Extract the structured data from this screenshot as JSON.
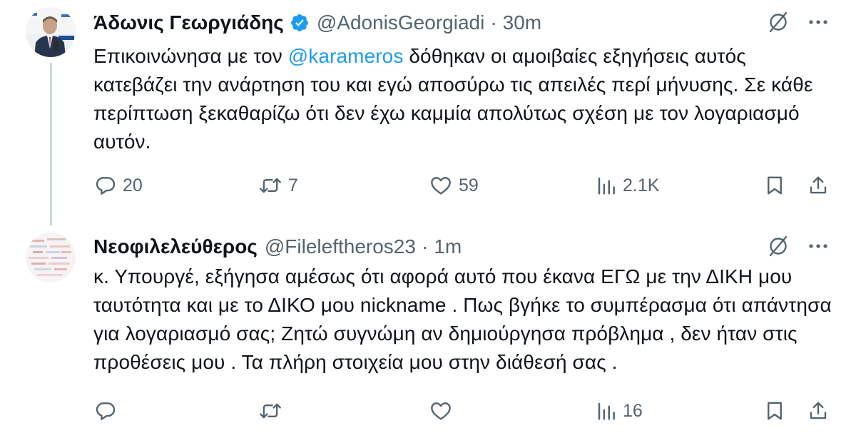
{
  "tweets": [
    {
      "display_name": "Άδωνις Γεωργιάδης",
      "handle": "@AdonisGeorgiadi",
      "separator": "·",
      "time": "30m",
      "verified": true,
      "text_before": "Επικοινώνησα με τον ",
      "mention": "@karameros",
      "text_after": " δόθηκαν οι αμοιβαίες εξηγήσεις αυτός κατεβάζει την ανάρτηση του και εγώ αποσύρω τις απειλές περί μήνυσης. Σε κάθε περίπτωση ξεκαθαρίζω ότι δεν έχω καμμία απολύτως σχέση με τον λογαριασμό αυτόν.",
      "reply_count": "20",
      "retweet_count": "7",
      "like_count": "59",
      "view_count": "2.1K"
    },
    {
      "display_name": "Νεοφιλελεύθερος",
      "handle": "@Fileleftheros23",
      "separator": "·",
      "time": "1m",
      "verified": false,
      "text": "κ. Υπουργέ, εξήγησα αμέσως ότι αφορά αυτό που έκανα ΕΓΩ με την ΔΙΚΗ μου ταυτότητα και με το ΔΙΚΟ μου nickname . Πως βγήκε το συμπέρασμα ότι απάντησα για λογαριασμό σας; Ζητώ συγνώμη αν δημιούργησα πρόβλημα , δεν ήταν στις προθέσεις μου . Τα πλήρη στοιχεία μου στην διάθεσή σας .",
      "reply_count": "",
      "retweet_count": "",
      "like_count": "",
      "view_count": "16"
    }
  ],
  "icons": {
    "verified": "verified-badge-icon",
    "grok": "slashed-circle-icon",
    "more": "more-dots-icon",
    "reply": "reply-icon",
    "retweet": "retweet-icon",
    "like": "heart-icon",
    "views": "views-bar-chart-icon",
    "bookmark": "bookmark-icon",
    "share": "share-icon"
  },
  "colors": {
    "text": "#0f1419",
    "secondary": "#536471",
    "link": "#1d9bf0",
    "verified": "#1d9bf0",
    "thread_line": "#cfd9de"
  }
}
